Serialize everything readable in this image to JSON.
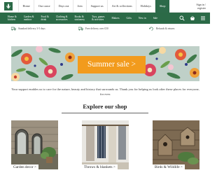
{
  "header": {
    "top_links": [
      "Home",
      "Our cause",
      "Days out",
      "Join",
      "Support us",
      "Art & collections",
      "Holidays",
      "Shop"
    ],
    "active_top_link": "Shop",
    "sign_in": {
      "line1": "Sign in /",
      "line2": "register"
    }
  },
  "nav": {
    "items": [
      {
        "line1": "Home &",
        "line2": "kitchen"
      },
      {
        "line1": "Garden &",
        "line2": "outdoor"
      },
      {
        "line1": "Food &",
        "line2": "drink"
      },
      {
        "line1": "Clothing &",
        "line2": "accessories"
      },
      {
        "line1": "Books &",
        "line2": "stationery"
      },
      {
        "line1": "Toys, games",
        "line2": "& activities"
      },
      {
        "line1": "Makers",
        "line2": ""
      },
      {
        "line1": "Gifts",
        "line2": ""
      },
      {
        "line1": "New in",
        "line2": ""
      },
      {
        "line1": "Sale",
        "line2": ""
      }
    ],
    "icons": [
      "search-icon",
      "basket-icon",
      "menu-icon"
    ]
  },
  "info_strip": {
    "delivery": "Standard delivery 3-5 days",
    "free_delivery": "Free delivery over £50",
    "refunds": "Refunds & returns"
  },
  "banner": {
    "cta": "Summer sale >"
  },
  "intro_text": "Your support enables us to care for the nature, beauty and history that surrounds us. Thank you for helping us look after these places for everyone, for ever.",
  "explore": {
    "heading": "Explore our shop"
  },
  "categories": [
    {
      "label": "Garden decor >"
    },
    {
      "label": "Throws & blankets >"
    },
    {
      "label": "Birds & Wildlife >"
    }
  ],
  "colors": {
    "nav_green": "#2b6a47",
    "sale_orange": "#f29b1d"
  }
}
